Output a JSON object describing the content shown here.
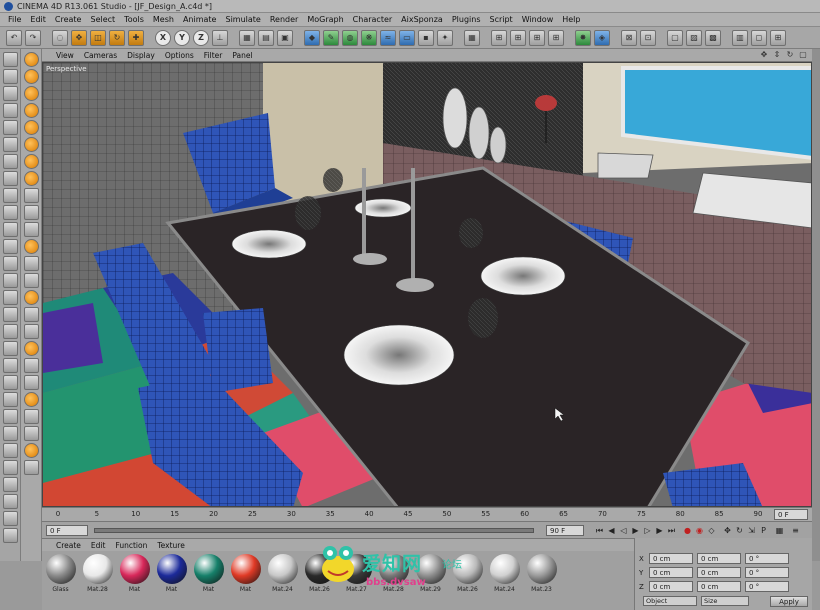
{
  "window": {
    "title": "CINEMA 4D R13.061 Studio - [JF_Design_A.c4d *]"
  },
  "menubar": [
    "File",
    "Edit",
    "Create",
    "Select",
    "Tools",
    "Mesh",
    "Animate",
    "Simulate",
    "Render",
    "MoGraph",
    "Character",
    "AixSponza",
    "Plugins",
    "Script",
    "Window",
    "Help"
  ],
  "toolbar": {
    "axis_x": "X",
    "axis_y": "Y",
    "axis_z": "Z"
  },
  "viewport": {
    "menu": [
      "View",
      "Cameras",
      "Display",
      "Options",
      "Filter",
      "Panel"
    ],
    "camera_label": "Perspective"
  },
  "timeline": {
    "ticks": [
      "0",
      "5",
      "10",
      "15",
      "20",
      "25",
      "30",
      "35",
      "40",
      "45",
      "50",
      "55",
      "60",
      "65",
      "70",
      "75",
      "80",
      "85",
      "90"
    ],
    "end_frame": "0 F"
  },
  "transport": {
    "current_frame": "0 F",
    "max_frame": "90 F",
    "start_frame": "0 F"
  },
  "materials": {
    "menu": [
      "Create",
      "Edit",
      "Function",
      "Texture"
    ],
    "items": [
      {
        "name": "Glass",
        "color": "#8a8a8a"
      },
      {
        "name": "Mat.28",
        "color": "#e8e8e8"
      },
      {
        "name": "Mat",
        "color": "#d8285a"
      },
      {
        "name": "Mat",
        "color": "#1c2a9a"
      },
      {
        "name": "Mat",
        "color": "#16806a"
      },
      {
        "name": "Mat",
        "color": "#e03a26"
      },
      {
        "name": "Mat.24",
        "color": "#c8c8c8"
      },
      {
        "name": "Mat.26",
        "color": "#2a2a2a"
      },
      {
        "name": "Mat.27",
        "color": "#3a3a3a"
      },
      {
        "name": "Mat.28",
        "color": "#777777"
      },
      {
        "name": "Mat.29",
        "color": "#8f8f8f"
      },
      {
        "name": "Mat.26",
        "color": "#b9b9b9"
      },
      {
        "name": "Mat.24",
        "color": "#d0d0d0"
      },
      {
        "name": "Mat.23",
        "color": "#9a9a9a"
      }
    ]
  },
  "coordinates": {
    "rows": [
      {
        "axis": "X",
        "pos": "0 cm",
        "size": "0 cm",
        "rot": "0 °"
      },
      {
        "axis": "Y",
        "pos": "0 cm",
        "size": "0 cm",
        "rot": "0 °"
      },
      {
        "axis": "Z",
        "pos": "0 cm",
        "size": "0 cm",
        "rot": "0 °"
      }
    ],
    "mode1": "Object",
    "mode2": "Size",
    "apply": "Apply"
  },
  "watermark": {
    "line1": "爱知网",
    "line2": "论坛",
    "line3": "bbs.dvsaw"
  }
}
